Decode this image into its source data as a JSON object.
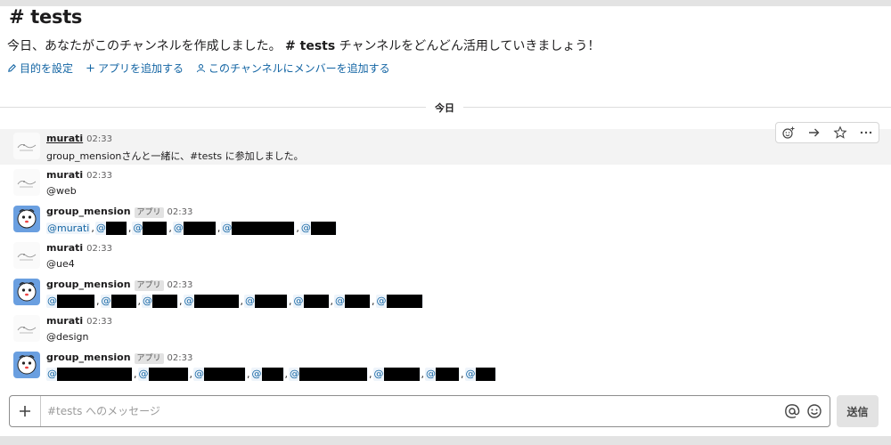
{
  "channel": {
    "title": "# tests",
    "intro_prefix": "今日、あなたがこのチャンネルを作成しました。",
    "intro_channel": "# tests",
    "intro_suffix": "チャンネルをどんどん活用していきましょう！",
    "actions": [
      {
        "label": "目的を設定",
        "icon": "pencil-icon"
      },
      {
        "label": "アプリを追加する",
        "icon": "plus-icon"
      },
      {
        "label": "このチャンネルにメンバーを追加する",
        "icon": "person-icon"
      }
    ]
  },
  "divider": {
    "label": "今日"
  },
  "messages": [
    {
      "user": "murati",
      "time": "02:33",
      "text": "group_mensionさんと一緒に、#tests に参加しました。"
    },
    {
      "user": "murati",
      "time": "02:33",
      "text": "@web"
    },
    {
      "user": "group_mension",
      "badge": "アプリ",
      "time": "02:33",
      "first_mention": "@murati"
    },
    {
      "user": "murati",
      "time": "02:33",
      "text": "@ue4"
    },
    {
      "user": "group_mension",
      "badge": "アプリ",
      "time": "02:33"
    },
    {
      "user": "murati",
      "time": "02:33",
      "text": "@design"
    },
    {
      "user": "group_mension",
      "badge": "アプリ",
      "time": "02:33"
    }
  ],
  "hover_toolbar": [
    "add-reaction-icon",
    "share-icon",
    "star-icon",
    "more-icon"
  ],
  "composer": {
    "placeholder": "#tests へのメッセージ",
    "send_label": "送信"
  },
  "colors": {
    "link": "#1264a3",
    "hover_bg": "#f3f3f3"
  }
}
